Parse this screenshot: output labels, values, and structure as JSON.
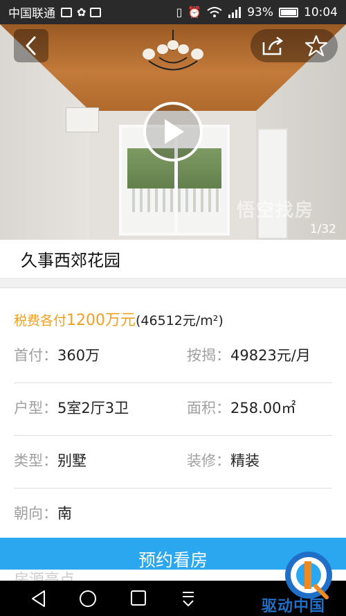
{
  "status": {
    "carrier": "中国联通",
    "battery": "93%",
    "time": "10:04"
  },
  "gallery": {
    "counter": "1/32",
    "watermark": "悟空找房"
  },
  "listing": {
    "title": "久事西郊花园",
    "price_prefix": "税费各付",
    "price_amount": "1200万元",
    "price_unit": "(46512元/m²)"
  },
  "details": [
    {
      "label1": "首付：",
      "value1": "360万",
      "label2": "按揭：",
      "value2": "49823元/月"
    },
    {
      "label1": "户型：",
      "value1": "5室2厅3卫",
      "label2": "面积：",
      "value2": "258.00㎡"
    },
    {
      "label1": "类型：",
      "value1": "别墅",
      "label2": "装修：",
      "value2": "精装"
    },
    {
      "label1": "朝向：",
      "value1": "南"
    }
  ],
  "section_peek": "房源亮点",
  "cta_label": "预约看房",
  "brand_text": "驱动中国",
  "colors": {
    "accent": "#2aa7ee",
    "price": "#f0a020"
  },
  "icons": [
    "back-icon",
    "share-icon",
    "star-icon",
    "play-icon",
    "nav-back-icon",
    "nav-home-icon",
    "nav-recent-icon",
    "nav-menu-icon"
  ]
}
